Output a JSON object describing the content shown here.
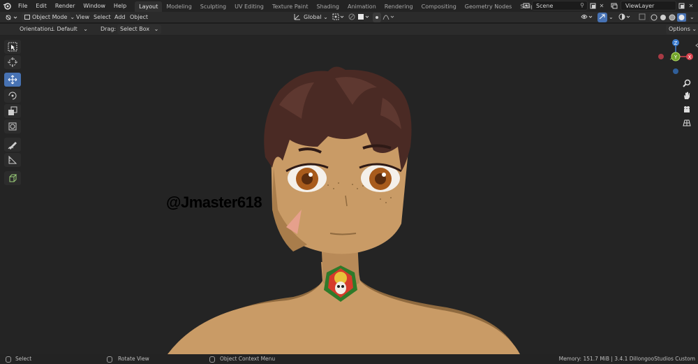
{
  "menu": {
    "items": [
      "File",
      "Edit",
      "Render",
      "Window",
      "Help"
    ]
  },
  "workspaces": {
    "tabs": [
      "Layout",
      "Modeling",
      "Sculpting",
      "UV Editing",
      "Texture Paint",
      "Shading",
      "Animation",
      "Rendering",
      "Compositing",
      "Geometry Nodes",
      "Scripting"
    ],
    "active": "Layout",
    "add_label": "+"
  },
  "scene": {
    "label": "Scene"
  },
  "view_layer": {
    "label": "ViewLayer"
  },
  "header": {
    "mode": "Object Mode",
    "menus": [
      "View",
      "Select",
      "Add",
      "Object"
    ],
    "transform_orientation": "Global"
  },
  "tool_options": {
    "orientation_label": "Orientation:",
    "orientation_value": "Default",
    "drag_label": "Drag:",
    "drag_value": "Select Box",
    "options_label": "Options"
  },
  "tools": [
    "select-box",
    "cursor",
    "move",
    "rotate",
    "scale",
    "transform",
    "annotate",
    "measure",
    "add-cube"
  ],
  "active_tool": "move",
  "gizmo": {
    "z_label": "Z",
    "x_label": "X",
    "y_label": "Y",
    "colors": {
      "x": "#d9444f",
      "y": "#73a52b",
      "z": "#3d7dd0"
    }
  },
  "watermark": "@Jmaster618",
  "status": {
    "select": "Select",
    "rotate_view": "Rotate View",
    "context_menu": "Object Context Menu",
    "stats": "Memory: 151.7 MiB | 3.4.1 DillongooStudios Custom"
  },
  "colors": {
    "active_tab": "#303030",
    "accent": "#4772b3",
    "viewport_bg": "#242424",
    "skin": "#c99b66",
    "hair": "#4a2a24",
    "iris": "#a85b1c"
  }
}
